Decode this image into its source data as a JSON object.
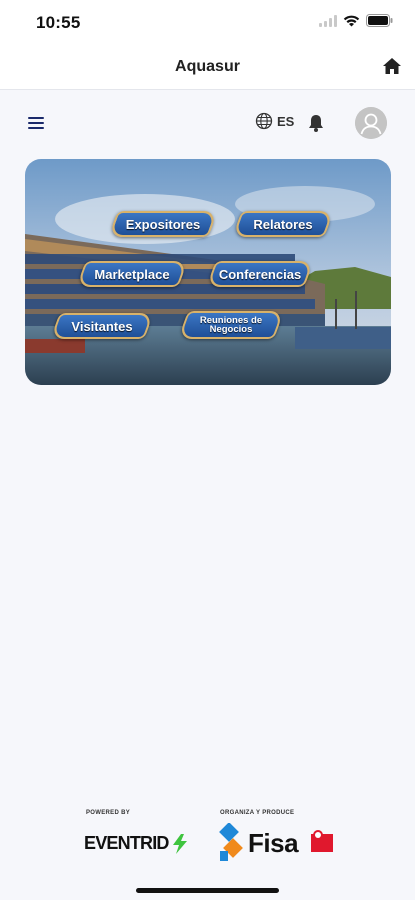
{
  "status_bar": {
    "time": "10:55",
    "icons": [
      "signal-icon",
      "wifi-icon",
      "battery-icon"
    ]
  },
  "header": {
    "title": "Aquasur",
    "home_icon": "home-icon"
  },
  "toolbar": {
    "menu_icon": "hamburger-menu-icon",
    "language": "ES",
    "language_icon": "globe-icon",
    "notifications_icon": "bell-icon",
    "avatar_icon": "user-avatar-icon"
  },
  "banner": {
    "buttons": {
      "expositores": "Expositores",
      "relatores": "Relatores",
      "marketplace": "Marketplace",
      "conferencias": "Conferencias",
      "visitantes": "Visitantes",
      "reuniones": "Reuniones de Negocios"
    }
  },
  "footer": {
    "powered_by": "POWERED BY",
    "powered_logo": "EVENTRID",
    "organiza": "ORGANIZA Y PRODUCE",
    "organizer_logo": "Fisa"
  },
  "colors": {
    "accent": "#1b2a6b",
    "banner_button": "#2f63b0",
    "banner_border": "#d8b26a",
    "eventrid_green": "#3ec43e",
    "fisa_blue": "#1e88d8",
    "partner_red": "#e0182d"
  }
}
